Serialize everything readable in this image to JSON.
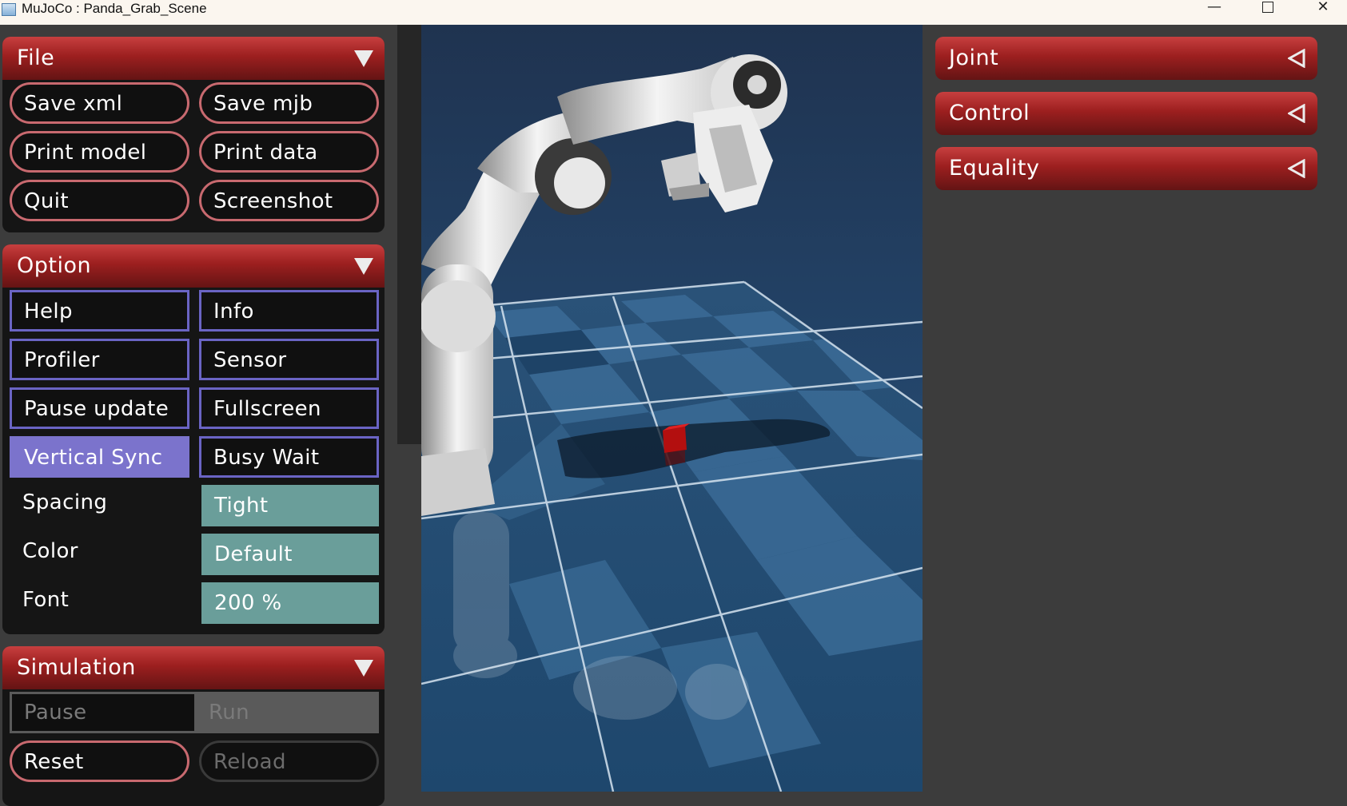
{
  "window": {
    "title": "MuJoCo : Panda_Grab_Scene",
    "controls": {
      "minimize": "—",
      "close": "✕"
    }
  },
  "left_panel": {
    "file": {
      "title": "File",
      "buttons": [
        "Save xml",
        "Save mjb",
        "Print model",
        "Print data",
        "Quit",
        "Screenshot"
      ]
    },
    "option": {
      "title": "Option",
      "toggles": [
        {
          "label": "Help",
          "active": false
        },
        {
          "label": "Info",
          "active": false
        },
        {
          "label": "Profiler",
          "active": false
        },
        {
          "label": "Sensor",
          "active": false
        },
        {
          "label": "Pause update",
          "active": false
        },
        {
          "label": "Fullscreen",
          "active": false
        },
        {
          "label": "Vertical Sync",
          "active": true
        },
        {
          "label": "Busy Wait",
          "active": false
        }
      ],
      "selects": [
        {
          "label": "Spacing",
          "value": "Tight"
        },
        {
          "label": "Color",
          "value": "Default"
        },
        {
          "label": "Font",
          "value": "200 %"
        }
      ]
    },
    "simulation": {
      "title": "Simulation",
      "radio": {
        "options": [
          "Pause",
          "Run"
        ]
      },
      "buttons": [
        "Reset",
        "Reload"
      ]
    }
  },
  "right_panel": {
    "sections": [
      "Joint",
      "Control",
      "Equality"
    ]
  },
  "viewport": {
    "scene_objects": [
      "panda-robot-arm",
      "red-cube",
      "checker-floor"
    ],
    "colors": {
      "sky_top": "#1f3350",
      "sky_bottom": "#2b5a86",
      "floor_dark": "#1f4468",
      "floor_light": "#3f709a",
      "cube": "#b30f0f"
    }
  }
}
